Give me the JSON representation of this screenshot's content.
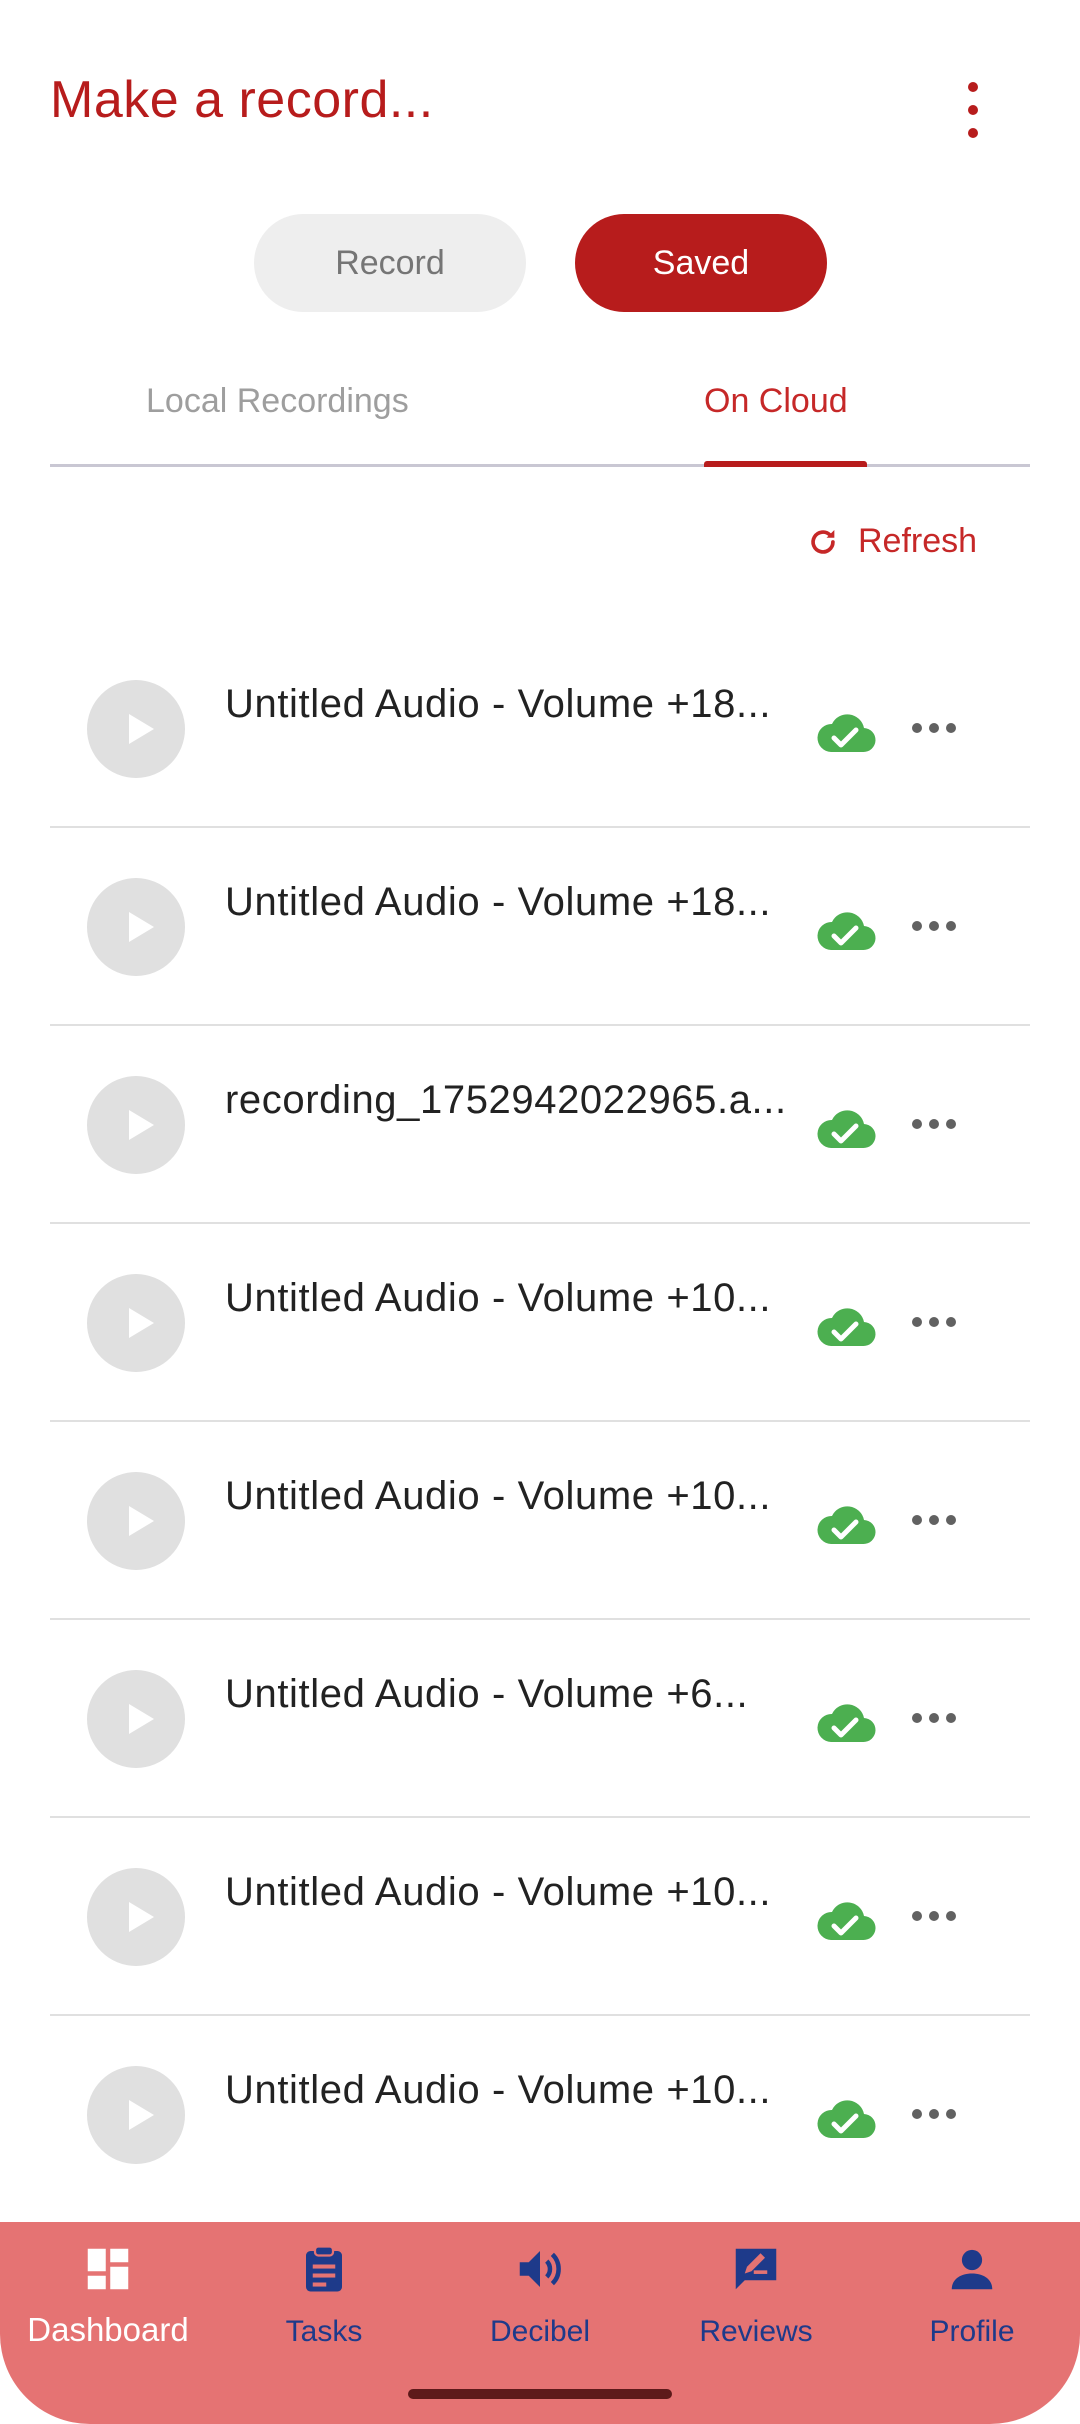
{
  "header": {
    "title": "Make a record..."
  },
  "segments": {
    "record_label": "Record",
    "saved_label": "Saved",
    "active": "Saved"
  },
  "tabs": [
    {
      "label": "Local Recordings",
      "active": false
    },
    {
      "label": "On Cloud",
      "active": true
    }
  ],
  "refresh_label": "Refresh",
  "recordings": [
    {
      "title": "Untitled Audio - Volume +18...",
      "status": "cloud-check-icon"
    },
    {
      "title": "Untitled Audio - Volume +18...",
      "status": "cloud-check-icon"
    },
    {
      "title": "recording_1752942022965.a...",
      "status": "cloud-check-icon"
    },
    {
      "title": "Untitled Audio - Volume +10...",
      "status": "cloud-check-icon"
    },
    {
      "title": "Untitled Audio - Volume +10...",
      "status": "cloud-check-icon"
    },
    {
      "title": "Untitled Audio - Volume +6...",
      "status": "cloud-check-icon"
    },
    {
      "title": "Untitled Audio - Volume +10...",
      "status": "cloud-check-icon"
    },
    {
      "title": "Untitled Audio - Volume +10...",
      "status": "cloud-check-icon"
    }
  ],
  "bottom_nav": [
    {
      "label": "Dashboard",
      "icon": "dashboard-icon",
      "active": true
    },
    {
      "label": "Tasks",
      "icon": "clipboard-icon",
      "active": false
    },
    {
      "label": "Decibel",
      "icon": "speaker-icon",
      "active": false
    },
    {
      "label": "Reviews",
      "icon": "rate-review-icon",
      "active": false
    },
    {
      "label": "Profile",
      "icon": "person-icon",
      "active": false
    }
  ],
  "colors": {
    "brand_red": "#b71c1c",
    "nav_bg": "#e57373",
    "nav_icon": "#1e3a8a",
    "cloud_ok": "#4caf50"
  }
}
